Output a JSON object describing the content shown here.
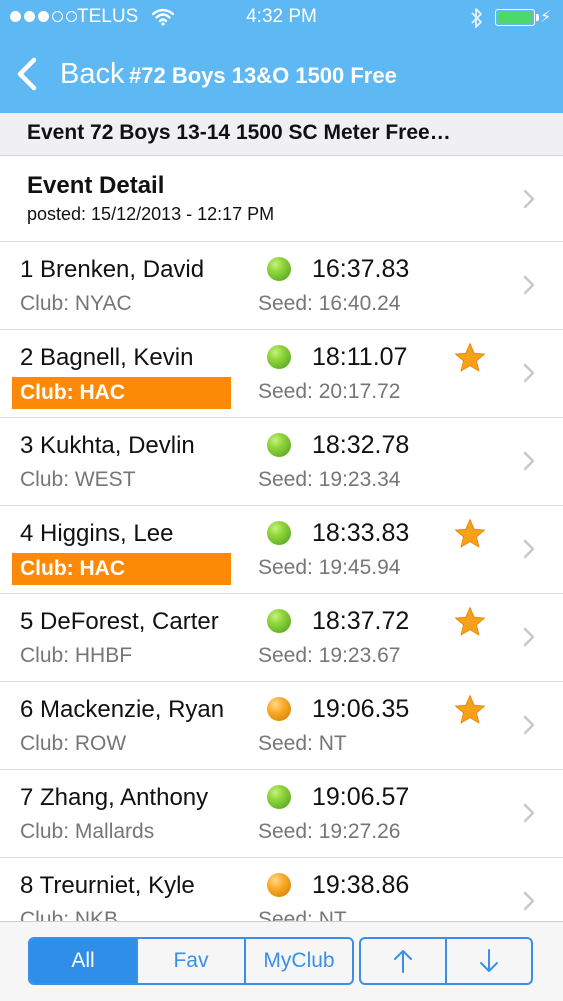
{
  "status_bar": {
    "carrier": "TELUS",
    "time": "4:32 PM",
    "signal_bars": 3,
    "signal_max": 5,
    "battery_level": 1.0
  },
  "nav": {
    "back_label": "Back",
    "title": "#72 Boys  13&O 1500 Free"
  },
  "event_header": "Event 72  Boys 13-14 1500 SC Meter Free…",
  "detail": {
    "title": "Event Detail",
    "posted": "posted: 15/12/2013 - 12:17 PM"
  },
  "results": [
    {
      "name": "1 Brenken, David",
      "club": "Club: NYAC",
      "time": "16:37.83",
      "seed": "Seed: 16:40.24",
      "status_color": "green",
      "favorite": false,
      "my_club": false
    },
    {
      "name": "2 Bagnell, Kevin",
      "club": "Club: HAC",
      "time": "18:11.07",
      "seed": "Seed: 20:17.72",
      "status_color": "green",
      "favorite": true,
      "my_club": true
    },
    {
      "name": "3 Kukhta, Devlin",
      "club": "Club: WEST",
      "time": "18:32.78",
      "seed": "Seed: 19:23.34",
      "status_color": "green",
      "favorite": false,
      "my_club": false
    },
    {
      "name": "4 Higgins, Lee",
      "club": "Club: HAC",
      "time": "18:33.83",
      "seed": "Seed: 19:45.94",
      "status_color": "green",
      "favorite": true,
      "my_club": true
    },
    {
      "name": "5 DeForest, Carter",
      "club": "Club: HHBF",
      "time": "18:37.72",
      "seed": "Seed: 19:23.67",
      "status_color": "green",
      "favorite": true,
      "my_club": false
    },
    {
      "name": "6 Mackenzie, Ryan",
      "club": "Club: ROW",
      "time": "19:06.35",
      "seed": "Seed:      NT",
      "status_color": "orange",
      "favorite": true,
      "my_club": false
    },
    {
      "name": "7 Zhang, Anthony",
      "club": "Club: Mallards",
      "time": "19:06.57",
      "seed": "Seed: 19:27.26",
      "status_color": "green",
      "favorite": false,
      "my_club": false
    },
    {
      "name": "8 Treurniet, Kyle",
      "club": "Club: NKB",
      "time": "19:38.86",
      "seed": "Seed:      NT",
      "status_color": "orange",
      "favorite": false,
      "my_club": false
    }
  ],
  "toolbar": {
    "filters": [
      {
        "label": "All",
        "active": true
      },
      {
        "label": "Fav",
        "active": false
      },
      {
        "label": "MyClub",
        "active": false
      }
    ],
    "sort_buttons": [
      "up-arrow-icon",
      "down-arrow-icon"
    ]
  },
  "colors": {
    "nav_background": "#5eb8f3",
    "accent": "#2f8ee8",
    "highlight_club": "#fd8a06",
    "star": "#f7a11a",
    "battery": "#4cd964"
  }
}
